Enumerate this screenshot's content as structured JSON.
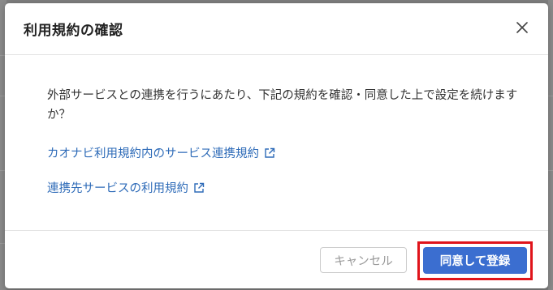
{
  "dialog": {
    "title": "利用規約の確認",
    "close_icon": "close-icon",
    "message": "外部サービスとの連携を行うにあたり、下記の規約を確認・同意した上で設定を続けますか？",
    "links": [
      {
        "label": "カオナビ利用規約内のサービス連携規約",
        "icon": "external-link-icon"
      },
      {
        "label": "連携先サービスの利用規約",
        "icon": "external-link-icon"
      }
    ],
    "cancel_label": "キャンセル",
    "agree_label": "同意して登録"
  },
  "colors": {
    "overlay": "#7d7d7d",
    "link": "#2e6bb8",
    "primary": "#3b6ed0",
    "highlight": "#e0141b"
  }
}
